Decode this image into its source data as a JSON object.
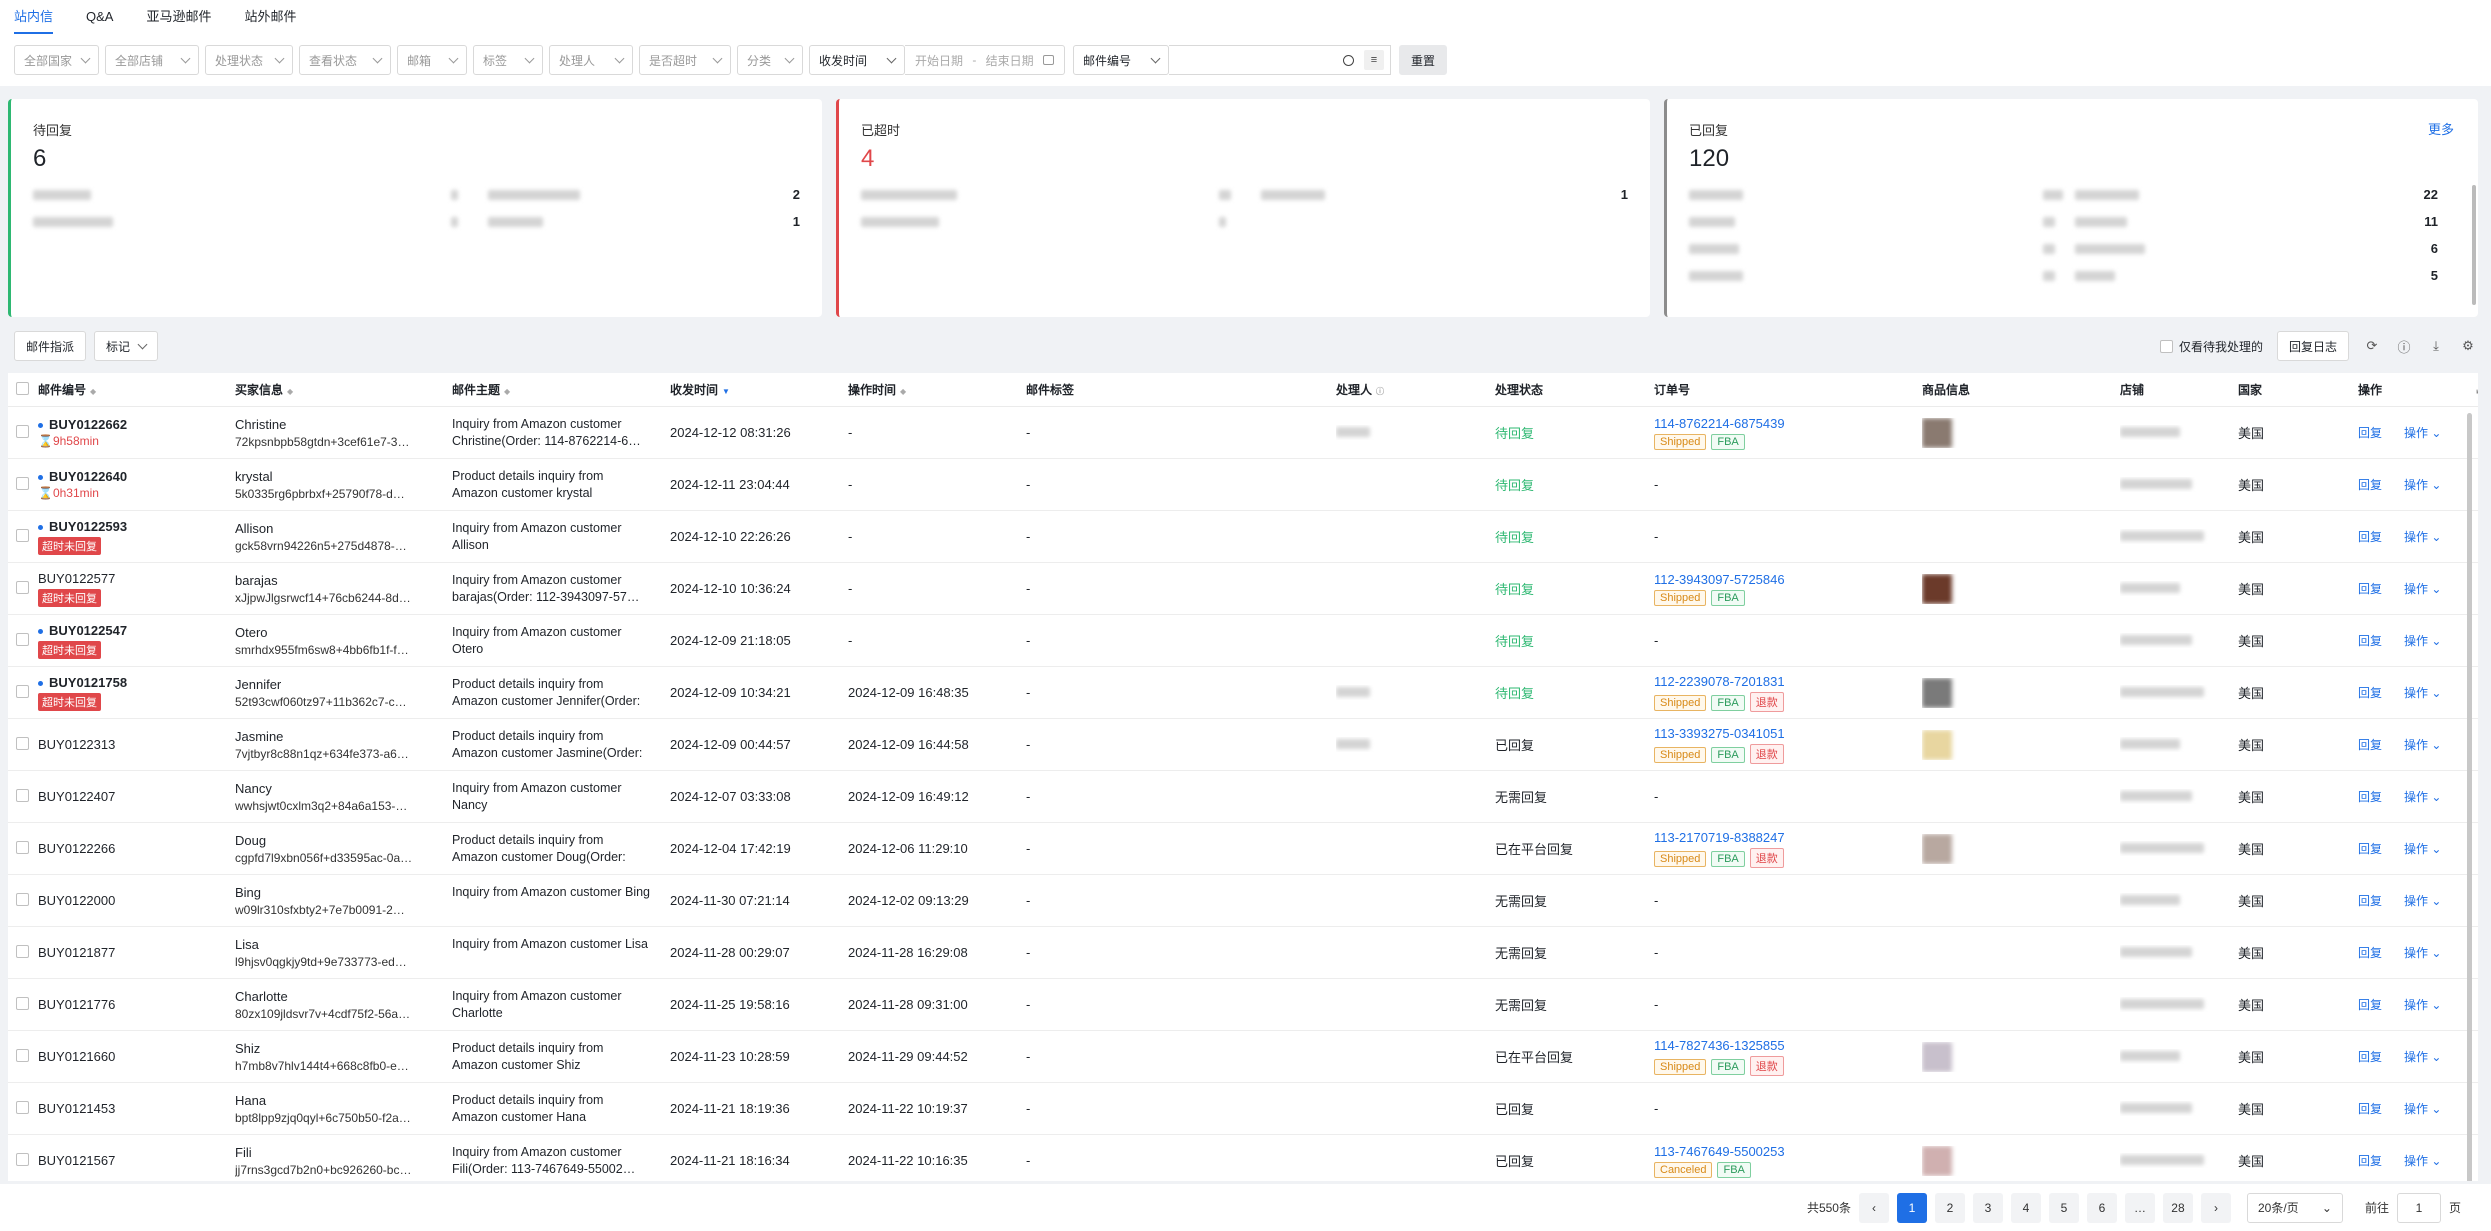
{
  "tabs": [
    "站内信",
    "Q&A",
    "亚马逊邮件",
    "站外邮件"
  ],
  "filters": {
    "country": "全部国家",
    "store": "全部店铺",
    "process_status": "处理状态",
    "view_status": "查看状态",
    "mailbox": "邮箱",
    "label": "标签",
    "handler": "处理人",
    "timeout": "是否超时",
    "category": "分类",
    "time_type": "收发时间",
    "date_start": "开始日期",
    "date_sep": "-",
    "date_end": "结束日期",
    "search_type": "邮件编号",
    "search_value": "",
    "reset": "重置"
  },
  "cards": [
    {
      "title": "待回复",
      "count": "6",
      "rows": [
        {
          "count": "2"
        },
        {
          "count": "1"
        }
      ]
    },
    {
      "title": "已超时",
      "count": "4",
      "rows": [
        {
          "count": "1"
        },
        {
          "count": ""
        }
      ]
    },
    {
      "title": "已回复",
      "count": "120",
      "more": "更多",
      "rows": [
        {
          "count": "22"
        },
        {
          "count": "11"
        },
        {
          "count": "6"
        },
        {
          "count": "5"
        }
      ]
    }
  ],
  "toolbar": {
    "assign": "邮件指派",
    "mark": "标记",
    "only_mine": "仅看待我处理的",
    "reply_log": "回复日志"
  },
  "columns": [
    "邮件编号",
    "买家信息",
    "邮件主题",
    "收发时间",
    "操作时间",
    "邮件标签",
    "处理人",
    "处理状态",
    "订单号",
    "商品信息",
    "店铺",
    "国家",
    "操作"
  ],
  "rows": [
    {
      "id": "BUY0122662",
      "bold": true,
      "timer": "9h58min",
      "badge": "",
      "buyer": "Christine",
      "buyer_id": "72kpsnbpb58gtdn+3cef61e7-3…",
      "subject": "Inquiry from Amazon customer Christine(Order: 114-8762214-6…",
      "recv": "2024-12-12 08:31:26",
      "op": "-",
      "label": "-",
      "status": "待回复",
      "status_green": true,
      "order": "114-8762214-6875439",
      "tags": [
        "Shipped",
        "FBA"
      ],
      "country": "美国",
      "thumb": "#8a7a70"
    },
    {
      "id": "BUY0122640",
      "bold": true,
      "timer": "0h31min",
      "badge": "",
      "buyer": "krystal",
      "buyer_id": "5k0335rg6pbrbxf+25790f78-d…",
      "subject": "Product details inquiry from Amazon customer krystal",
      "recv": "2024-12-11 23:04:44",
      "op": "-",
      "label": "-",
      "status": "待回复",
      "status_green": true,
      "order": "",
      "tags": [],
      "country": "美国",
      "thumb": ""
    },
    {
      "id": "BUY0122593",
      "bold": true,
      "timer": "",
      "badge": "超时未回复",
      "buyer": "Allison",
      "buyer_id": "gck58vrn94226n5+275d4878-…",
      "subject": "Inquiry from Amazon customer Allison",
      "recv": "2024-12-10 22:26:26",
      "op": "-",
      "label": "-",
      "status": "待回复",
      "status_green": true,
      "order": "",
      "tags": [],
      "country": "美国",
      "thumb": ""
    },
    {
      "id": "BUY0122577",
      "bold": false,
      "timer": "",
      "badge": "超时未回复",
      "buyer": "barajas",
      "buyer_id": "xJjpwJlgsrwcf14+76cb6244-8d…",
      "subject": "Inquiry from Amazon customer barajas(Order: 112-3943097-57…",
      "recv": "2024-12-10 10:36:24",
      "op": "-",
      "label": "-",
      "status": "待回复",
      "status_green": true,
      "order": "112-3943097-5725846",
      "tags": [
        "Shipped",
        "FBA"
      ],
      "country": "美国",
      "thumb": "#6b3a2a"
    },
    {
      "id": "BUY0122547",
      "bold": true,
      "timer": "",
      "badge": "超时未回复",
      "buyer": "Otero",
      "buyer_id": "smrhdx955fm6sw8+4bb6fb1f-f…",
      "subject": "Inquiry from Amazon customer Otero",
      "recv": "2024-12-09 21:18:05",
      "op": "-",
      "label": "-",
      "status": "待回复",
      "status_green": true,
      "order": "",
      "tags": [],
      "country": "美国",
      "thumb": ""
    },
    {
      "id": "BUY0121758",
      "bold": true,
      "timer": "",
      "badge": "超时未回复",
      "buyer": "Jennifer",
      "buyer_id": "52t93cwf060tz97+11b362c7-c…",
      "subject": "Product details inquiry from Amazon customer Jennifer(Order: 1…",
      "recv": "2024-12-09 10:34:21",
      "op": "2024-12-09 16:48:35",
      "label": "-",
      "status": "待回复",
      "status_green": true,
      "order": "112-2239078-7201831",
      "tags": [
        "Shipped",
        "FBA",
        "退款"
      ],
      "country": "美国",
      "thumb": "#7a7a7a"
    },
    {
      "id": "BUY0122313",
      "bold": false,
      "timer": "",
      "badge": "",
      "buyer": "Jasmine",
      "buyer_id": "7vjtbyr8c88n1qz+634fe373-a6…",
      "subject": "Product details inquiry from Amazon customer Jasmine(Order: 1…",
      "recv": "2024-12-09 00:44:57",
      "op": "2024-12-09 16:44:58",
      "label": "-",
      "status": "已回复",
      "status_green": false,
      "order": "113-3393275-0341051",
      "tags": [
        "Shipped",
        "FBA",
        "退款"
      ],
      "country": "美国",
      "thumb": "#e8d6a0"
    },
    {
      "id": "BUY0122407",
      "bold": false,
      "timer": "",
      "badge": "",
      "buyer": "Nancy",
      "buyer_id": "wwhsjwt0cxlm3q2+84a6a153-…",
      "subject": "Inquiry from Amazon customer Nancy",
      "recv": "2024-12-07 03:33:08",
      "op": "2024-12-09 16:49:12",
      "label": "-",
      "status": "无需回复",
      "status_green": false,
      "order": "",
      "tags": [],
      "country": "美国",
      "thumb": ""
    },
    {
      "id": "BUY0122266",
      "bold": false,
      "timer": "",
      "badge": "",
      "buyer": "Doug",
      "buyer_id": "cgpfd7l9xbn056f+d33595ac-0a…",
      "subject": "Product details inquiry from Amazon customer Doug(Order: 113…",
      "recv": "2024-12-04 17:42:19",
      "op": "2024-12-06 11:29:10",
      "label": "-",
      "status": "已在平台回复",
      "status_green": false,
      "order": "113-2170719-8388247",
      "tags": [
        "Shipped",
        "FBA",
        "退款"
      ],
      "country": "美国",
      "thumb": "#b8a8a0"
    },
    {
      "id": "BUY0122000",
      "bold": false,
      "timer": "",
      "badge": "",
      "buyer": "Bing",
      "buyer_id": "w09lr310sfxbty2+7e7b0091-2…",
      "subject": "Inquiry from Amazon customer Bing",
      "recv": "2024-11-30 07:21:14",
      "op": "2024-12-02 09:13:29",
      "label": "-",
      "status": "无需回复",
      "status_green": false,
      "order": "",
      "tags": [],
      "country": "美国",
      "thumb": ""
    },
    {
      "id": "BUY0121877",
      "bold": false,
      "timer": "",
      "badge": "",
      "buyer": "Lisa",
      "buyer_id": "l9hjsv0qgkjy9td+9e733773-ed…",
      "subject": "Inquiry from Amazon customer Lisa",
      "recv": "2024-11-28 00:29:07",
      "op": "2024-11-28 16:29:08",
      "label": "-",
      "status": "无需回复",
      "status_green": false,
      "order": "",
      "tags": [],
      "country": "美国",
      "thumb": ""
    },
    {
      "id": "BUY0121776",
      "bold": false,
      "timer": "",
      "badge": "",
      "buyer": "Charlotte",
      "buyer_id": "80zx109jldsvr7v+4cdf75f2-56a…",
      "subject": "Inquiry from Amazon customer Charlotte",
      "recv": "2024-11-25 19:58:16",
      "op": "2024-11-28 09:31:00",
      "label": "-",
      "status": "无需回复",
      "status_green": false,
      "order": "",
      "tags": [],
      "country": "美国",
      "thumb": ""
    },
    {
      "id": "BUY0121660",
      "bold": false,
      "timer": "",
      "badge": "",
      "buyer": "Shiz",
      "buyer_id": "h7mb8v7hlv144t4+668c8fb0-e…",
      "subject": "Product details inquiry from Amazon customer Shiz",
      "recv": "2024-11-23 10:28:59",
      "op": "2024-11-29 09:44:52",
      "label": "-",
      "status": "已在平台回复",
      "status_green": false,
      "order": "114-7827436-1325855",
      "tags": [
        "Shipped",
        "FBA",
        "退款"
      ],
      "country": "美国",
      "thumb": "#c8c0cc"
    },
    {
      "id": "BUY0121453",
      "bold": false,
      "timer": "",
      "badge": "",
      "buyer": "Hana",
      "buyer_id": "bpt8lpp9zjq0qyl+6c750b50-f2a…",
      "subject": "Product details inquiry from Amazon customer Hana",
      "recv": "2024-11-21 18:19:36",
      "op": "2024-11-22 10:19:37",
      "label": "-",
      "status": "已回复",
      "status_green": false,
      "order": "",
      "tags": [],
      "country": "美国",
      "thumb": ""
    },
    {
      "id": "BUY0121567",
      "bold": false,
      "timer": "",
      "badge": "",
      "buyer": "Fili",
      "buyer_id": "jj7rns3gcd7b2n0+bc926260-bc…",
      "subject": "Inquiry from Amazon customer Fili(Order: 113-7467649-55002…",
      "recv": "2024-11-21 18:16:34",
      "op": "2024-11-22 10:16:35",
      "label": "-",
      "status": "已回复",
      "status_green": false,
      "order": "113-7467649-5500253",
      "tags": [
        "Canceled",
        "FBA"
      ],
      "country": "美国",
      "thumb": "#d0b0b0"
    }
  ],
  "row_ops": {
    "reply": "回复",
    "action": "操作"
  },
  "pagination": {
    "total": "共550条",
    "pages": [
      "1",
      "2",
      "3",
      "4",
      "5",
      "6",
      "…",
      "28"
    ],
    "current": "1",
    "page_size": "20条/页",
    "goto": "前往",
    "goto_value": "1",
    "page_unit": "页"
  },
  "colors": {
    "accent": "#1f6fe5",
    "danger": "#e0474a",
    "success": "#2eb872"
  }
}
